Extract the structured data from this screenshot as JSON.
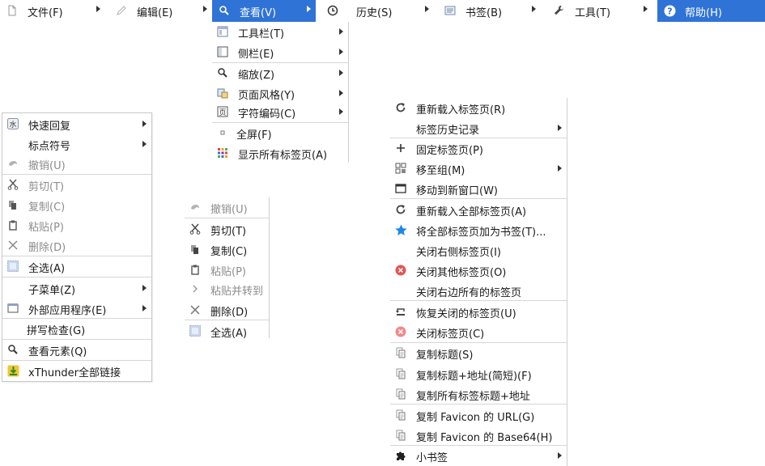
{
  "menubar": [
    {
      "label": "文件(F)",
      "icon": "file-icon"
    },
    {
      "label": "编辑(E)",
      "icon": "pencil-icon"
    },
    {
      "label": "查看(V)",
      "icon": "search-icon"
    },
    {
      "label": "历史(S)",
      "icon": "clock-icon"
    },
    {
      "label": "书签(B)",
      "icon": "bookmarks-icon"
    },
    {
      "label": "工具(T)",
      "icon": "wrench-icon"
    },
    {
      "label": "帮助(H)",
      "icon": "help-icon"
    }
  ],
  "view_menu": [
    {
      "label": "工具栏(T)",
      "icon": "toolbar-icon",
      "arrow": true
    },
    {
      "label": "侧栏(E)",
      "icon": "sidebar-icon",
      "arrow": true
    },
    {
      "label": "缩放(Z)",
      "icon": "zoom-icon",
      "arrow": true
    },
    {
      "label": "页面风格(Y)",
      "icon": "page-style-icon",
      "arrow": true
    },
    {
      "label": "字符编码(C)",
      "icon": "encoding-icon",
      "arrow": true
    },
    {
      "label": "全屏(F)",
      "icon": "fullscreen-icon"
    },
    {
      "label": "显示所有标签页(A)",
      "icon": "grid-icon"
    }
  ],
  "context_menu": [
    {
      "label": "快速回复",
      "icon": "quick-reply-icon",
      "arrow": true
    },
    {
      "label": "标点符号",
      "arrow": true
    },
    {
      "label": "撤销(U)",
      "icon": "undo-icon",
      "disabled": true
    },
    {
      "label": "剪切(T)",
      "icon": "cut-icon",
      "disabled": true
    },
    {
      "label": "复制(C)",
      "icon": "copy-icon",
      "disabled": true
    },
    {
      "label": "粘贴(P)",
      "icon": "paste-icon",
      "disabled": true
    },
    {
      "label": "删除(D)",
      "icon": "delete-icon",
      "disabled": true
    },
    {
      "label": "全选(A)",
      "icon": "select-all-icon"
    },
    {
      "label": "子菜单(Z)",
      "arrow": true
    },
    {
      "label": "外部应用程序(E)",
      "icon": "external-app-icon",
      "arrow": true
    },
    {
      "label": "拼写检查(G)"
    },
    {
      "label": "查看元素(Q)",
      "icon": "inspect-icon"
    },
    {
      "label": "xThunder全部链接",
      "icon": "xthunder-icon"
    }
  ],
  "edit_menu": [
    {
      "label": "撤销(U)",
      "icon": "undo-icon",
      "disabled": true
    },
    {
      "label": "剪切(T)",
      "icon": "cut-icon"
    },
    {
      "label": "复制(C)",
      "icon": "copy-icon"
    },
    {
      "label": "粘贴(P)",
      "icon": "paste-icon",
      "disabled": true
    },
    {
      "label": "粘贴并转到",
      "icon": "paste-go-icon",
      "disabled": true
    },
    {
      "label": "删除(D)",
      "icon": "delete-icon"
    },
    {
      "label": "全选(A)",
      "icon": "select-all-icon"
    }
  ],
  "tab_menu": [
    {
      "label": "重新载入标签页(R)",
      "icon": "reload-icon"
    },
    {
      "label": "标签历史记录",
      "arrow": true
    },
    {
      "label": "固定标签页(P)",
      "icon": "plus-icon"
    },
    {
      "label": "移至组(M)",
      "icon": "group-icon",
      "arrow": true
    },
    {
      "label": "移动到新窗口(W)",
      "icon": "window-icon"
    },
    {
      "label": "重新载入全部标签页(A)",
      "icon": "reload-icon"
    },
    {
      "label": "将全部标签页加为书签(T)...",
      "icon": "star-icon"
    },
    {
      "label": "关闭右侧标签页(I)"
    },
    {
      "label": "关闭其他标签页(O)",
      "icon": "close-red-icon"
    },
    {
      "label": "关闭右边所有的标签页"
    },
    {
      "label": "恢复关闭的标签页(U)",
      "icon": "restore-icon"
    },
    {
      "label": "关闭标签页(C)",
      "icon": "close-light-icon"
    },
    {
      "label": "复制标题(S)",
      "icon": "doc-copy-icon"
    },
    {
      "label": "复制标题+地址(简短)(F)",
      "icon": "doc-copy-icon"
    },
    {
      "label": "复制所有标签标题+地址",
      "icon": "doc-copy-icon"
    },
    {
      "label": "复制 Favicon 的 URL(G)",
      "icon": "doc-copy-icon"
    },
    {
      "label": "复制 Favicon 的 Base64(H)",
      "icon": "doc-copy-icon"
    },
    {
      "label": "小书签",
      "icon": "puzzle-icon",
      "arrow": true
    }
  ],
  "colors": {
    "accent": "#2f73d6",
    "disabled": "#8c8c8c",
    "close_red": "#e05555"
  }
}
